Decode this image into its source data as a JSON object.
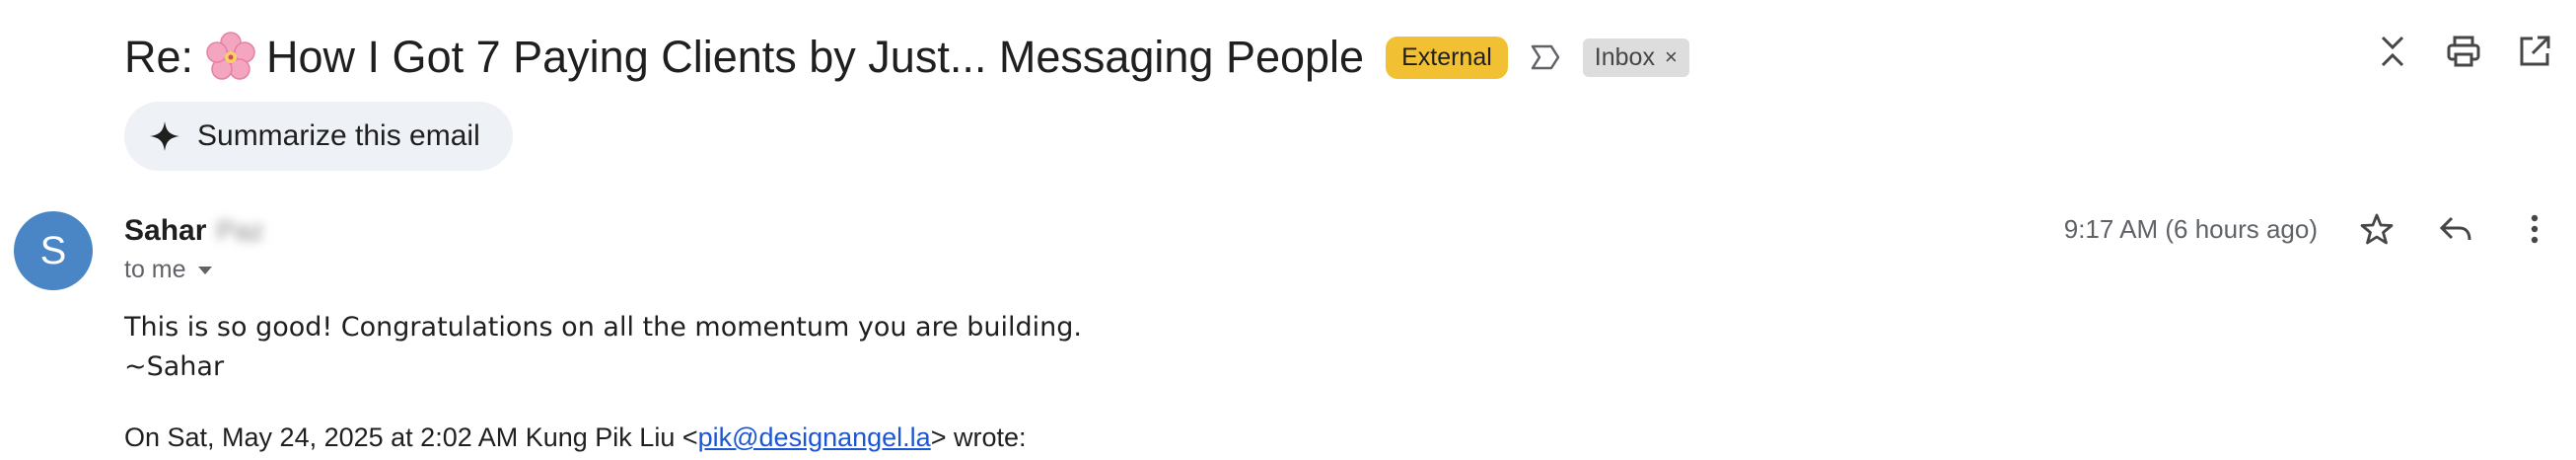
{
  "email": {
    "subject_prefix": "Re:",
    "subject_text": "How I Got 7 Paying Clients by Just... Messaging People",
    "labels": {
      "external": "External",
      "inbox": "Inbox",
      "inbox_remove": "×"
    },
    "summarize_label": "Summarize this email",
    "sender": {
      "avatar_letter": "S",
      "name": "Sahar",
      "blurred_surname": "Paz",
      "to_line": "to me",
      "timestamp": "9:17 AM (6 hours ago)"
    },
    "body_lines": [
      "This is so good! Congratulations on all the momentum you are building.",
      "~Sahar"
    ],
    "quote": {
      "prefix": "On Sat, May 24, 2025 at 2:02 AM Kung Pik Liu <",
      "email_link": "pik@designangel.la",
      "suffix": "> wrote:"
    }
  },
  "toolbar_icons": [
    "collapse-icon",
    "print-icon",
    "open-in-new-window-icon"
  ],
  "message_icons": [
    "star-icon",
    "reply-icon",
    "more-vert-icon"
  ],
  "colors": {
    "external_badge": "#f2c133",
    "inbox_badge": "#dddddd",
    "avatar": "#4a86c5",
    "summarize_chip": "#eef1f6",
    "link": "#1a56d6"
  }
}
